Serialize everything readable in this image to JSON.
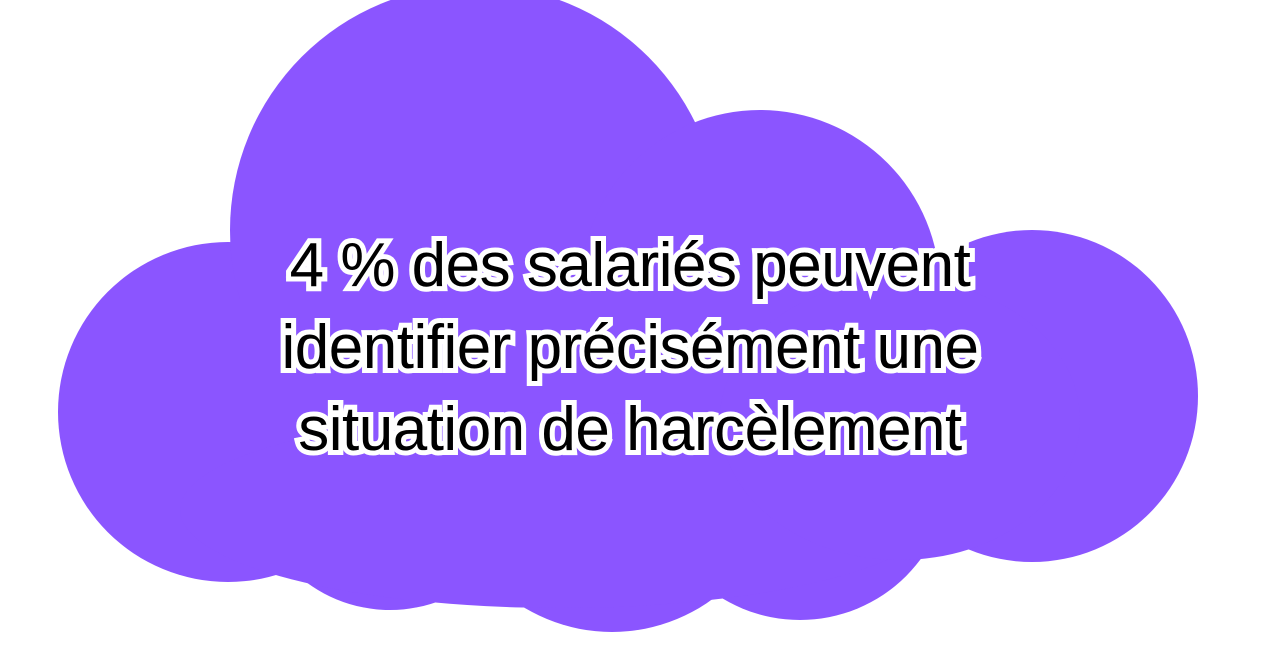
{
  "colors": {
    "cloud": "#8B55FF",
    "background": "#FFFFFF",
    "text": "#000000",
    "text_outline": "#FFFFFF"
  },
  "cloud": {
    "lines": [
      "4 % des salariés peuvent",
      "identifier précisément une",
      "situation de harcèlement"
    ]
  }
}
